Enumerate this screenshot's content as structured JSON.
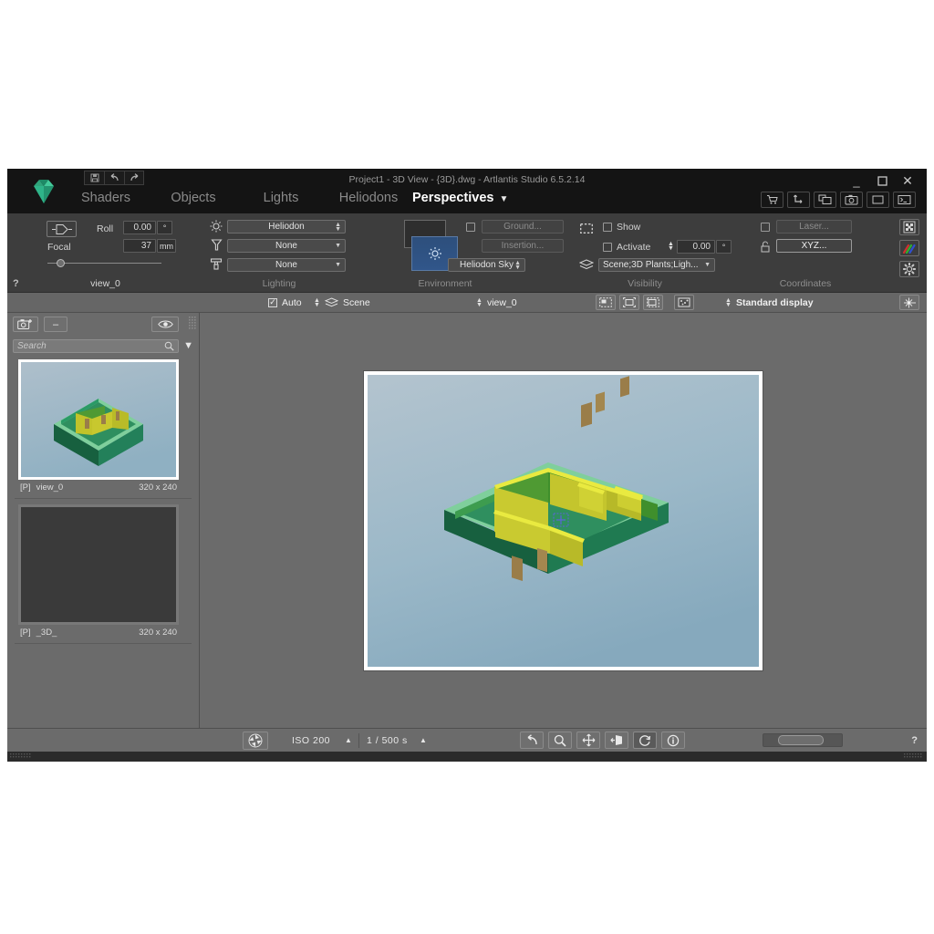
{
  "window": {
    "title": "Project1 - 3D View - {3D}.dwg - Artlantis Studio 6.5.2.14",
    "minimize": "_",
    "maximize": "❐",
    "close": "✕",
    "logo_icon": "artlantis-diamond-logo",
    "save_icon": "save-icon",
    "undo_icon": "undo-icon",
    "redo_icon": "redo-icon"
  },
  "mainnav": {
    "items": [
      {
        "label": "Shaders",
        "active": false
      },
      {
        "label": "Objects",
        "active": false
      },
      {
        "label": "Lights",
        "active": false
      },
      {
        "label": "Heliodons",
        "active": false
      },
      {
        "label": "Perspectives",
        "active": true
      }
    ],
    "caret": "▼",
    "right_icons": [
      "cart-icon",
      "export-icon",
      "windows-icon",
      "camera-icon",
      "crop-icon",
      "console-icon"
    ]
  },
  "camera": {
    "section_label": "view_0",
    "help": "?",
    "fov_icon": "field-of-view-icon",
    "roll_label": "Roll",
    "roll_value": "0.00",
    "roll_unit": "°",
    "focal_label": "Focal",
    "focal_value": "37",
    "focal_unit": "mm",
    "slider_percent": 12
  },
  "lighting": {
    "section_label": "Lighting",
    "rows": [
      {
        "icon": "sun-icon",
        "value": "Heliodon",
        "control": "stepper"
      },
      {
        "icon": "spotlight-icon",
        "value": "None",
        "control": "dropdown"
      },
      {
        "icon": "light-brush-icon",
        "value": "None",
        "control": "dropdown"
      }
    ]
  },
  "environment": {
    "section_label": "Environment",
    "swatch_color": "#2e2e2e",
    "preview_icon": "sun-preview-icon",
    "preview_color": "#2d4f7c",
    "checkbox_checked": false,
    "ground_button": "Ground...",
    "insertion_button": "Insertion...",
    "sky_select": "Heliodon Sky"
  },
  "visibility": {
    "section_label": "Visibility",
    "marquee_icon": "selection-marquee-icon",
    "show_label": "Show",
    "show_checked": false,
    "activate_label": "Activate",
    "activate_checked": false,
    "angle_value": "0.00",
    "angle_unit": "°",
    "layers_icon": "layers-icon",
    "layers_value": "Scene;3D Plants;Ligh..."
  },
  "coordinates": {
    "section_label": "Coordinates",
    "laser_checked": false,
    "laser_button": "Laser...",
    "lock_icon": "lock-icon",
    "xyz_button": "XYZ..."
  },
  "right_tools": [
    {
      "icon": "checker-aperture-icon"
    },
    {
      "icon": "axis-colors-icon"
    },
    {
      "icon": "gear-icon"
    }
  ],
  "toolbar2": {
    "auto_label": "Auto",
    "auto_checked": true,
    "layers_icon": "layers-icon",
    "scene_value": "Scene",
    "view_value": "view_0",
    "view_icons": [
      "insert-region-icon",
      "fit-to-window-icon",
      "crop-region-icon",
      "render-preview-icon"
    ],
    "display_mode": "Standard display",
    "flare_icon": "light-flare-icon"
  },
  "sidebar": {
    "add_view_icon": "camera-plus-icon",
    "remove_label": "–",
    "eye_icon": "eye-icon",
    "grip_icon": "grip-icon",
    "search_placeholder": "Search",
    "search_icon": "search-icon",
    "filter_caret": "▼",
    "items": [
      {
        "prefix": "[P]",
        "name": "view_0",
        "size": "320 x 240",
        "selected": true
      },
      {
        "prefix": "[P]",
        "name": "_3D_",
        "size": "320 x 240",
        "selected": false
      }
    ]
  },
  "statusbar": {
    "aperture_icon": "aperture-icon",
    "iso_label": "ISO  200",
    "iso_caret": "▲",
    "shutter_label": "1 /  500 s",
    "shutter_caret": "▲",
    "tools": [
      {
        "icon": "undo-arrow-icon",
        "active": false
      },
      {
        "icon": "zoom-icon",
        "active": false
      },
      {
        "icon": "pan-move-icon",
        "active": false
      },
      {
        "icon": "door-exit-icon",
        "active": false
      },
      {
        "icon": "refresh-icon",
        "active": true
      },
      {
        "icon": "info-icon",
        "active": false
      }
    ],
    "help": "?"
  },
  "render": {
    "sky_top": "#aebfcb",
    "sky_bottom": "#8fb0c2",
    "wall_outer": "#1f7a51",
    "wall_outer_dark": "#18623f",
    "wall_top": "#7fcf9c",
    "wall_inner_green": "#4f9a33",
    "wall_inner_yellow": "#c2c32a",
    "door_color": "#9a7d49",
    "marker_color": "#5b63d8"
  }
}
